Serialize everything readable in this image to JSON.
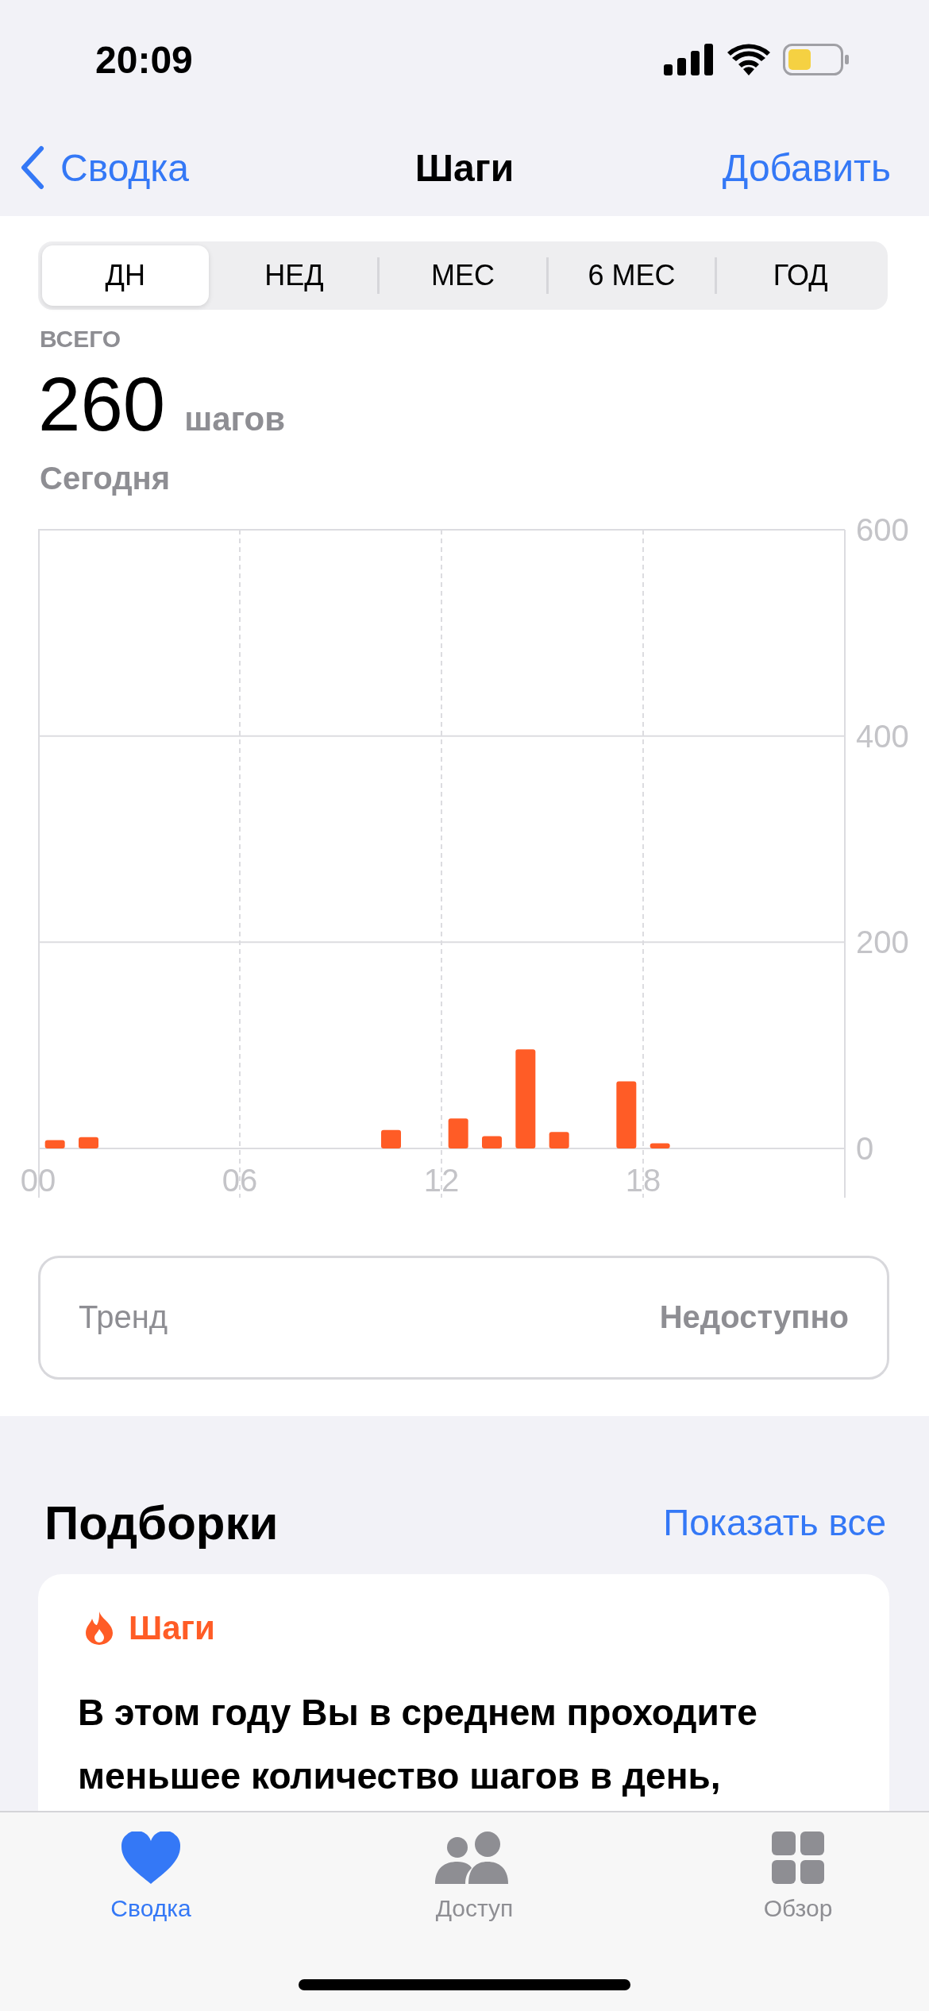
{
  "status_bar": {
    "time": "20:09"
  },
  "nav": {
    "back": "Сводка",
    "title": "Шаги",
    "action": "Добавить"
  },
  "segments": [
    {
      "label": "ДН",
      "selected": true
    },
    {
      "label": "НЕД",
      "selected": false
    },
    {
      "label": "МЕС",
      "selected": false
    },
    {
      "label": "6 МЕС",
      "selected": false
    },
    {
      "label": "ГОД",
      "selected": false
    }
  ],
  "summary": {
    "caption": "ВСЕГО",
    "value": "260",
    "unit": "шагов",
    "period": "Сегодня"
  },
  "chart_data": {
    "type": "bar",
    "x": [
      0.5,
      1.5,
      2.5,
      3.5,
      4.5,
      5.5,
      6.5,
      7.5,
      8.5,
      9.5,
      10.5,
      11.5,
      12.5,
      13.5,
      14.5,
      15.5,
      16.5,
      17.5,
      18.5,
      19.5,
      20.5,
      21.5,
      22.5,
      23.5
    ],
    "series": [
      {
        "color": "#ff5c26",
        "values": [
          8,
          11,
          0,
          0,
          0,
          0,
          0,
          0,
          0,
          0,
          18,
          0,
          29,
          12,
          96,
          16,
          0,
          65,
          5,
          0,
          0,
          0,
          0,
          0
        ]
      }
    ],
    "xlim": [
      0,
      24
    ],
    "ylim": [
      0,
      600
    ],
    "grid": true,
    "xticks": [
      {
        "value": 0,
        "label": "00"
      },
      {
        "value": 6,
        "label": "06"
      },
      {
        "value": 12,
        "label": "12"
      },
      {
        "value": 18,
        "label": "18"
      }
    ],
    "yticks": [
      0,
      200,
      400,
      600
    ]
  },
  "trend": {
    "label": "Тренд",
    "value": "Недоступно"
  },
  "highlights": {
    "title": "Подборки",
    "action": "Показать все",
    "card": {
      "category": "Шаги",
      "text": "В этом году Вы в среднем проходите меньшее количество шагов в день,"
    }
  },
  "tab_bar": [
    {
      "label": "Сводка",
      "selected": true
    },
    {
      "label": "Доступ",
      "selected": false
    },
    {
      "label": "Обзор",
      "selected": false
    }
  ]
}
